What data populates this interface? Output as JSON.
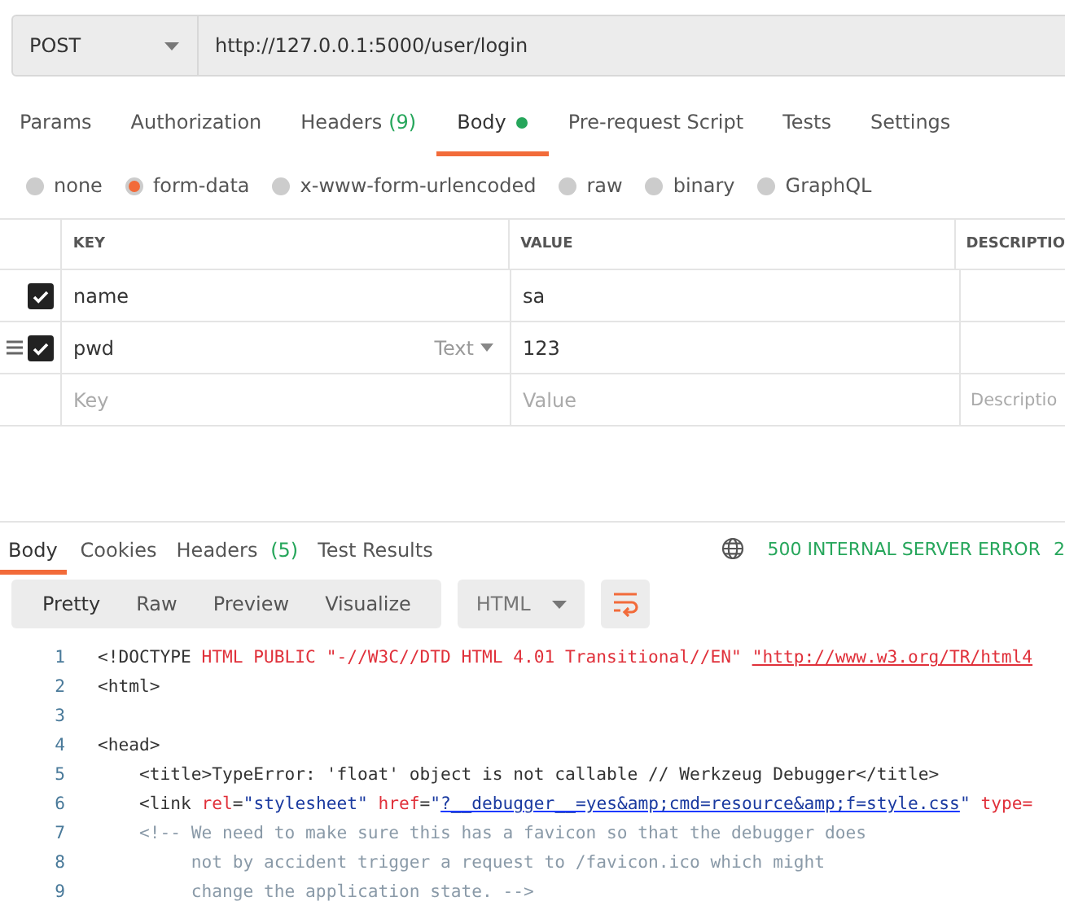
{
  "request": {
    "method": "POST",
    "url": "http://127.0.0.1:5000/user/login"
  },
  "request_tabs": [
    {
      "label": "Params",
      "selected": false
    },
    {
      "label": "Authorization",
      "selected": false
    },
    {
      "label": "Headers",
      "count": "(9)",
      "selected": false
    },
    {
      "label": "Body",
      "dot": true,
      "selected": true
    },
    {
      "label": "Pre-request Script",
      "selected": false
    },
    {
      "label": "Tests",
      "selected": false
    },
    {
      "label": "Settings",
      "selected": false
    }
  ],
  "body_types": [
    {
      "label": "none",
      "selected": false
    },
    {
      "label": "form-data",
      "selected": true
    },
    {
      "label": "x-www-form-urlencoded",
      "selected": false
    },
    {
      "label": "raw",
      "selected": false
    },
    {
      "label": "binary",
      "selected": false
    },
    {
      "label": "GraphQL",
      "selected": false
    }
  ],
  "form_table": {
    "columns": [
      "KEY",
      "VALUE",
      "DESCRIPTIO"
    ],
    "rows": [
      {
        "checked": true,
        "key": "name",
        "value": "sa"
      },
      {
        "checked": true,
        "key": "pwd",
        "type": "Text",
        "value": "123"
      }
    ],
    "new_row": {
      "key_placeholder": "Key",
      "value_placeholder": "Value",
      "description_placeholder": "Descriptio"
    }
  },
  "response_tabs": [
    {
      "label": "Body",
      "selected": true
    },
    {
      "label": "Cookies",
      "selected": false
    },
    {
      "label": "Headers",
      "count": "(5)",
      "selected": false
    },
    {
      "label": "Test Results",
      "selected": false
    }
  ],
  "status": "500 INTERNAL SERVER ERROR",
  "status_extra": "2",
  "view_modes": [
    {
      "label": "Pretty",
      "selected": true
    },
    {
      "label": "Raw",
      "selected": false
    },
    {
      "label": "Preview",
      "selected": false
    },
    {
      "label": "Visualize",
      "selected": false
    }
  ],
  "format": "HTML",
  "code_lines": [
    {
      "number": "1",
      "tokens": [
        {
          "kind": "tag",
          "text": "<!DOCTYPE "
        },
        {
          "kind": "attr",
          "text": "HTML PUBLIC \"-//W3C//DTD HTML 4.01 Transitional//EN\" "
        },
        {
          "kind": "link-red",
          "text": "\"http://www.w3.org/TR/html4"
        }
      ]
    },
    {
      "number": "2",
      "tokens": [
        {
          "kind": "tag",
          "text": "<html>"
        }
      ]
    },
    {
      "number": "3"
    },
    {
      "number": "4",
      "tokens": [
        {
          "kind": "tag",
          "text": "<head>"
        }
      ]
    },
    {
      "number": "5",
      "tokens": [
        {
          "kind": "tag",
          "text": "    <title>TypeError: 'float' object is not callable // Werkzeug Debugger</title>"
        }
      ]
    },
    {
      "number": "6",
      "tokens": [
        {
          "kind": "tag",
          "text": "    <link "
        },
        {
          "kind": "attr",
          "text": "rel"
        },
        {
          "kind": "tag",
          "text": "="
        },
        {
          "kind": "string",
          "text": "\"stylesheet\" "
        },
        {
          "kind": "attr",
          "text": "href"
        },
        {
          "kind": "tag",
          "text": "="
        },
        {
          "kind": "string",
          "text": "\""
        },
        {
          "kind": "link",
          "text": "?__debugger__=yes&amp;cmd=resource&amp;f=style.css"
        },
        {
          "kind": "string",
          "text": "\" "
        },
        {
          "kind": "attr",
          "text": "type="
        }
      ]
    },
    {
      "number": "7",
      "tokens": [
        {
          "kind": "comment",
          "text": "    <!-- We need to make sure this has a favicon so that the debugger does"
        }
      ]
    },
    {
      "number": "8",
      "tokens": [
        {
          "kind": "comment",
          "text": "         not by accident trigger a request to /favicon.ico which might"
        }
      ]
    },
    {
      "number": "9",
      "tokens": [
        {
          "kind": "comment",
          "text": "         change the application state. -->"
        }
      ]
    }
  ]
}
